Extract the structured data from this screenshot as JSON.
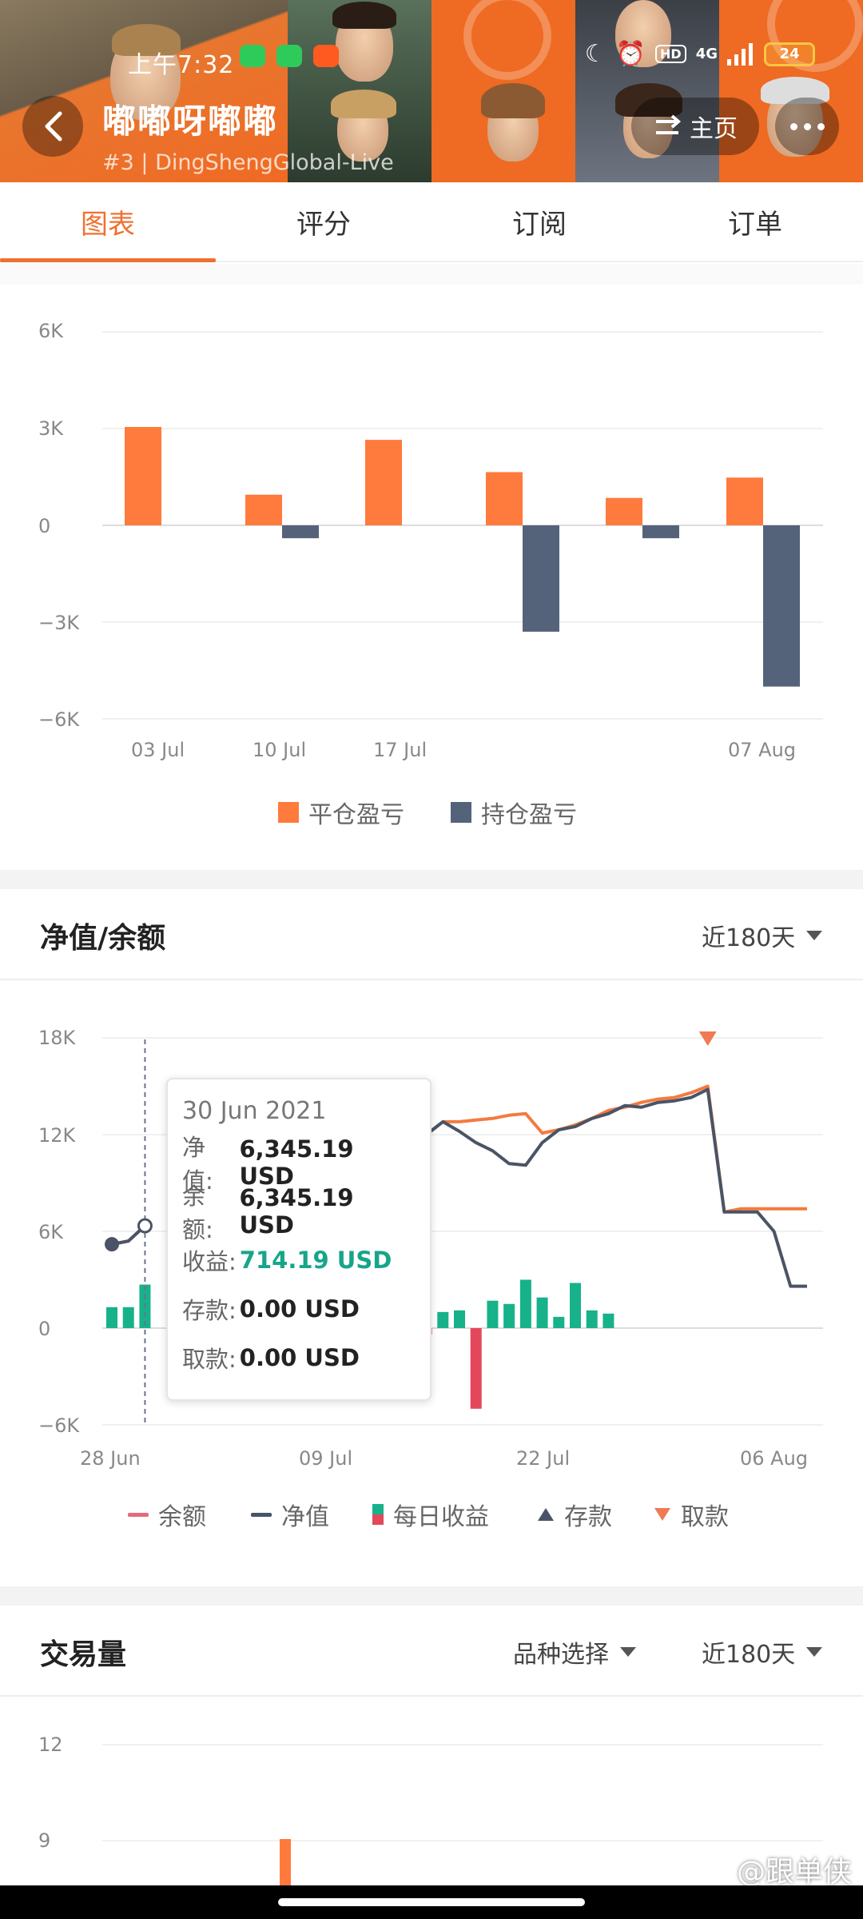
{
  "status_bar": {
    "time": "上午7:32",
    "hd": "HD",
    "network": "4G",
    "battery": "24"
  },
  "header": {
    "title": "嘟嘟呀嘟嘟",
    "subtitle": "#3 | DingShengGlobal-Live",
    "home_label": "主页"
  },
  "tabs": [
    {
      "label": "图表",
      "active": true
    },
    {
      "label": "评分",
      "active": false
    },
    {
      "label": "订阅",
      "active": false
    },
    {
      "label": "订单",
      "active": false
    }
  ],
  "chart_data": [
    {
      "type": "bar",
      "yticks": [
        "6K",
        "3K",
        "0",
        "−3K",
        "−6K"
      ],
      "xticks": [
        "03 Jul",
        "10 Jul",
        "17 Jul",
        "07 Aug"
      ],
      "ylim": [
        -6000,
        6000
      ],
      "series": [
        {
          "name": "平仓盈亏",
          "color": "#ff7a3d",
          "values": [
            3050,
            950,
            2650,
            1650,
            850,
            1480
          ]
        },
        {
          "name": "持仓盈亏",
          "color": "#55637a",
          "values": [
            0,
            -400,
            0,
            -3300,
            -400,
            -5000
          ]
        }
      ]
    },
    {
      "type": "line",
      "title": "净值/余额",
      "range_label": "近180天",
      "yticks": [
        "18K",
        "12K",
        "6K",
        "0",
        "−6K"
      ],
      "xticks": [
        "28 Jun",
        "09 Jul",
        "22 Jul",
        "06 Aug"
      ],
      "ylim": [
        -6000,
        18000
      ],
      "x_days": [
        28,
        29,
        30,
        31,
        32,
        33,
        34,
        35,
        36,
        37,
        38,
        39,
        40,
        41,
        42,
        43,
        44,
        45,
        46,
        47,
        48,
        49,
        50,
        51,
        52,
        53,
        54,
        55,
        56,
        57,
        58,
        59,
        60,
        61,
        62,
        63,
        64,
        65,
        66,
        67,
        68,
        69,
        70
      ],
      "balance": [
        5200,
        5400,
        6345,
        null,
        null,
        null,
        null,
        null,
        null,
        null,
        null,
        null,
        null,
        null,
        null,
        null,
        null,
        11300,
        11700,
        12000,
        12800,
        12800,
        12900,
        13000,
        13200,
        13300,
        12100,
        12300,
        12600,
        13000,
        13500,
        13700,
        14000,
        14200,
        14300,
        14600,
        15000,
        7200,
        7400,
        7400,
        7400,
        7400,
        7400
      ],
      "equity": [
        5200,
        5400,
        6345,
        null,
        null,
        null,
        null,
        null,
        null,
        null,
        null,
        null,
        null,
        null,
        null,
        null,
        null,
        11300,
        11700,
        12000,
        12800,
        12200,
        11500,
        11000,
        10200,
        10100,
        11500,
        12300,
        12500,
        13000,
        13300,
        13800,
        13700,
        14000,
        14100,
        14300,
        14800,
        7200,
        7200,
        7200,
        6000,
        2600,
        2600
      ],
      "daily_profit": [
        {
          "d": 28,
          "v": 1300
        },
        {
          "d": 29,
          "v": 1300
        },
        {
          "d": 30,
          "v": 2700
        },
        {
          "d": 43,
          "v": 1700
        },
        {
          "d": 44,
          "v": 1400
        },
        {
          "d": 45,
          "v": 2900
        },
        {
          "d": 47,
          "v": -400
        },
        {
          "d": 48,
          "v": 1000
        },
        {
          "d": 49,
          "v": 1100
        },
        {
          "d": 50,
          "v": -5000
        },
        {
          "d": 51,
          "v": 1700
        },
        {
          "d": 52,
          "v": 1500
        },
        {
          "d": 53,
          "v": 3000
        },
        {
          "d": 54,
          "v": 1900
        },
        {
          "d": 55,
          "v": 700
        },
        {
          "d": 56,
          "v": 2800
        },
        {
          "d": 57,
          "v": 1100
        },
        {
          "d": 58,
          "v": 900
        }
      ],
      "withdrawal_marker_day": 64,
      "legend": [
        "余额",
        "净值",
        "每日收益",
        "存款",
        "取款"
      ],
      "colors": {
        "balance": "#f47a3e",
        "equity": "#4a5466",
        "profit_pos": "#17b28a",
        "profit_neg": "#e2485a",
        "deposit": "#4a5466",
        "withdrawal": "#f07a54"
      }
    },
    {
      "type": "bar",
      "title": "交易量",
      "filter_label": "品种选择",
      "range_label": "近180天",
      "yticks": [
        "12",
        "9"
      ]
    }
  ],
  "tooltip": {
    "date": "30 Jun 2021",
    "rows": [
      {
        "label": "净值:",
        "value": "6,345.19 USD"
      },
      {
        "label": "余额:",
        "value": "6,345.19 USD"
      },
      {
        "label": "收益:",
        "value": "714.19 USD"
      },
      {
        "label": "存款:",
        "value": "0.00 USD"
      },
      {
        "label": "取款:",
        "value": "0.00 USD"
      }
    ]
  },
  "watermark": "@跟单侠"
}
